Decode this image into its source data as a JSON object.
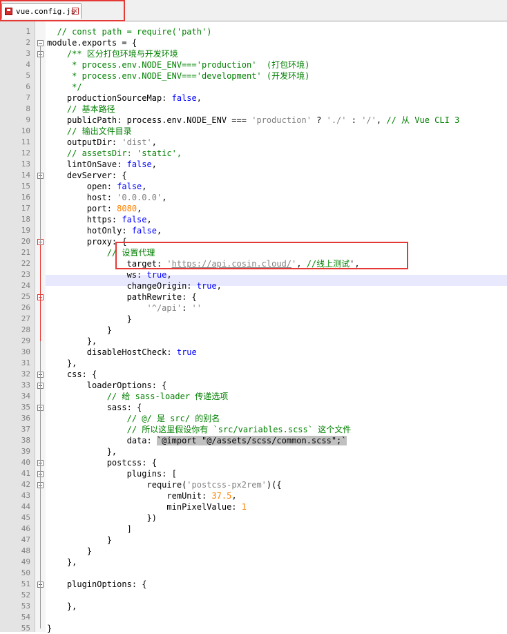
{
  "tab": {
    "filename": "vue.config.js",
    "close_glyph": "✕"
  },
  "colors": {
    "comment": "#008000",
    "keyword": "#0000ff",
    "string": "#808080",
    "number": "#ff8000",
    "highlight_box": "#e53935",
    "current_line": "#e8e8ff"
  },
  "current_line_number": 24,
  "lines": [
    {
      "n": "1",
      "t": [
        [
          "cm",
          "  // const path = require('path')"
        ]
      ]
    },
    {
      "n": "2",
      "t": [
        [
          "plain",
          "module.exports = {"
        ]
      ]
    },
    {
      "n": "3",
      "t": [
        [
          "cm",
          "    /** 区分打包环境与开发环境"
        ]
      ]
    },
    {
      "n": "4",
      "t": [
        [
          "cm",
          "     * process.env.NODE_ENV==='production'  (打包环境)"
        ]
      ]
    },
    {
      "n": "5",
      "t": [
        [
          "cm",
          "     * process.env.NODE_ENV==='development' (开发环境)"
        ]
      ]
    },
    {
      "n": "6",
      "t": [
        [
          "cm",
          "     */"
        ]
      ]
    },
    {
      "n": "7",
      "t": [
        [
          "plain",
          "    productionSourceMap: "
        ],
        [
          "kw",
          "false"
        ],
        [
          "plain",
          ","
        ]
      ]
    },
    {
      "n": "8",
      "t": [
        [
          "cm",
          "    // 基本路径"
        ]
      ]
    },
    {
      "n": "9",
      "t": [
        [
          "plain",
          "    publicPath: process.env.NODE_ENV === "
        ],
        [
          "str",
          "'production'"
        ],
        [
          "plain",
          " ? "
        ],
        [
          "str",
          "'./'"
        ],
        [
          "plain",
          " : "
        ],
        [
          "str",
          "'/'"
        ],
        [
          "plain",
          ", "
        ],
        [
          "cm",
          "// 从 Vue CLI 3"
        ]
      ]
    },
    {
      "n": "10",
      "t": [
        [
          "cm",
          "    // 输出文件目录"
        ]
      ]
    },
    {
      "n": "11",
      "t": [
        [
          "plain",
          "    outputDir: "
        ],
        [
          "str",
          "'dist'"
        ],
        [
          "plain",
          ","
        ]
      ]
    },
    {
      "n": "12",
      "t": [
        [
          "cm",
          "    // assetsDir: 'static',"
        ]
      ]
    },
    {
      "n": "13",
      "t": [
        [
          "plain",
          "    lintOnSave: "
        ],
        [
          "kw",
          "false"
        ],
        [
          "plain",
          ","
        ]
      ]
    },
    {
      "n": "14",
      "t": [
        [
          "plain",
          "    devServer: {"
        ]
      ]
    },
    {
      "n": "15",
      "t": [
        [
          "plain",
          "        open: "
        ],
        [
          "kw",
          "false"
        ],
        [
          "plain",
          ","
        ]
      ]
    },
    {
      "n": "16",
      "t": [
        [
          "plain",
          "        host: "
        ],
        [
          "str",
          "'0.0.0.0'"
        ],
        [
          "plain",
          ","
        ]
      ]
    },
    {
      "n": "17",
      "t": [
        [
          "plain",
          "        port: "
        ],
        [
          "num",
          "8080"
        ],
        [
          "plain",
          ","
        ]
      ]
    },
    {
      "n": "18",
      "t": [
        [
          "plain",
          "        https: "
        ],
        [
          "kw",
          "false"
        ],
        [
          "plain",
          ","
        ]
      ]
    },
    {
      "n": "19",
      "t": [
        [
          "plain",
          "        hotOnly: "
        ],
        [
          "kw",
          "false"
        ],
        [
          "plain",
          ","
        ]
      ]
    },
    {
      "n": "20",
      "t": [
        [
          "plain",
          "        proxy: {"
        ]
      ]
    },
    {
      "n": "21",
      "t": [
        [
          "cm",
          "            // 设置代理"
        ]
      ]
    },
    {
      "n": "22",
      "t": [
        [
          "plain",
          "                target: "
        ],
        [
          "str",
          "'"
        ],
        [
          "link",
          "https://api.cosin.cloud/"
        ],
        [
          "str",
          "'"
        ],
        [
          "plain",
          ", "
        ],
        [
          "cm",
          "//线上测试"
        ],
        [
          "plain",
          "',"
        ]
      ]
    },
    {
      "n": "23",
      "t": [
        [
          "plain",
          "                ws: "
        ],
        [
          "kw",
          "true"
        ],
        [
          "plain",
          ","
        ]
      ]
    },
    {
      "n": "24",
      "t": [
        [
          "plain",
          "                changeOrigin: "
        ],
        [
          "kw",
          "true"
        ],
        [
          "plain",
          ","
        ]
      ]
    },
    {
      "n": "25",
      "t": [
        [
          "plain",
          "                pathRewrite: {"
        ]
      ]
    },
    {
      "n": "26",
      "t": [
        [
          "plain",
          "                    "
        ],
        [
          "str",
          "'^/api'"
        ],
        [
          "plain",
          ": "
        ],
        [
          "str",
          "''"
        ]
      ]
    },
    {
      "n": "27",
      "t": [
        [
          "plain",
          "                }"
        ]
      ]
    },
    {
      "n": "28",
      "t": [
        [
          "plain",
          "            }"
        ]
      ]
    },
    {
      "n": "29",
      "t": [
        [
          "plain",
          "        },"
        ]
      ]
    },
    {
      "n": "30",
      "t": [
        [
          "plain",
          "        disableHostCheck: "
        ],
        [
          "kw",
          "true"
        ]
      ]
    },
    {
      "n": "31",
      "t": [
        [
          "plain",
          "    },"
        ]
      ]
    },
    {
      "n": "32",
      "t": [
        [
          "plain",
          "    css: {"
        ]
      ]
    },
    {
      "n": "33",
      "t": [
        [
          "plain",
          "        loaderOptions: {"
        ]
      ]
    },
    {
      "n": "34",
      "t": [
        [
          "cm",
          "            // 给 sass-loader 传递选项"
        ]
      ]
    },
    {
      "n": "35",
      "t": [
        [
          "plain",
          "            sass: {"
        ]
      ]
    },
    {
      "n": "36",
      "t": [
        [
          "cm",
          "                // @/ 是 src/ 的别名"
        ]
      ]
    },
    {
      "n": "37",
      "t": [
        [
          "cm",
          "                // 所以这里假设你有 `src/variables.scss` 这个文件"
        ]
      ]
    },
    {
      "n": "38",
      "t": [
        [
          "plain",
          "                data: "
        ],
        [
          "sel",
          "`@import \"@/assets/scss/common.scss\";`"
        ]
      ]
    },
    {
      "n": "39",
      "t": [
        [
          "plain",
          "            },"
        ]
      ]
    },
    {
      "n": "40",
      "t": [
        [
          "plain",
          "            postcss: {"
        ]
      ]
    },
    {
      "n": "41",
      "t": [
        [
          "plain",
          "                plugins: ["
        ]
      ]
    },
    {
      "n": "42",
      "t": [
        [
          "plain",
          "                    require("
        ],
        [
          "str",
          "'postcss-px2rem'"
        ],
        [
          "plain",
          ")({"
        ]
      ]
    },
    {
      "n": "43",
      "t": [
        [
          "plain",
          "                        remUnit: "
        ],
        [
          "num",
          "37.5"
        ],
        [
          "plain",
          ","
        ]
      ]
    },
    {
      "n": "44",
      "t": [
        [
          "plain",
          "                        minPixelValue: "
        ],
        [
          "num",
          "1"
        ]
      ]
    },
    {
      "n": "45",
      "t": [
        [
          "plain",
          "                    })"
        ]
      ]
    },
    {
      "n": "46",
      "t": [
        [
          "plain",
          "                ]"
        ]
      ]
    },
    {
      "n": "47",
      "t": [
        [
          "plain",
          "            }"
        ]
      ]
    },
    {
      "n": "48",
      "t": [
        [
          "plain",
          "        }"
        ]
      ]
    },
    {
      "n": "49",
      "t": [
        [
          "plain",
          "    },"
        ]
      ]
    },
    {
      "n": "50",
      "t": [
        [
          "plain",
          ""
        ]
      ]
    },
    {
      "n": "51",
      "t": [
        [
          "plain",
          "    pluginOptions: {"
        ]
      ]
    },
    {
      "n": "52",
      "t": [
        [
          "plain",
          ""
        ]
      ]
    },
    {
      "n": "53",
      "t": [
        [
          "plain",
          "    },"
        ]
      ]
    },
    {
      "n": "54",
      "t": [
        [
          "plain",
          ""
        ]
      ]
    },
    {
      "n": "55",
      "t": [
        [
          "plain",
          "}"
        ]
      ]
    }
  ]
}
